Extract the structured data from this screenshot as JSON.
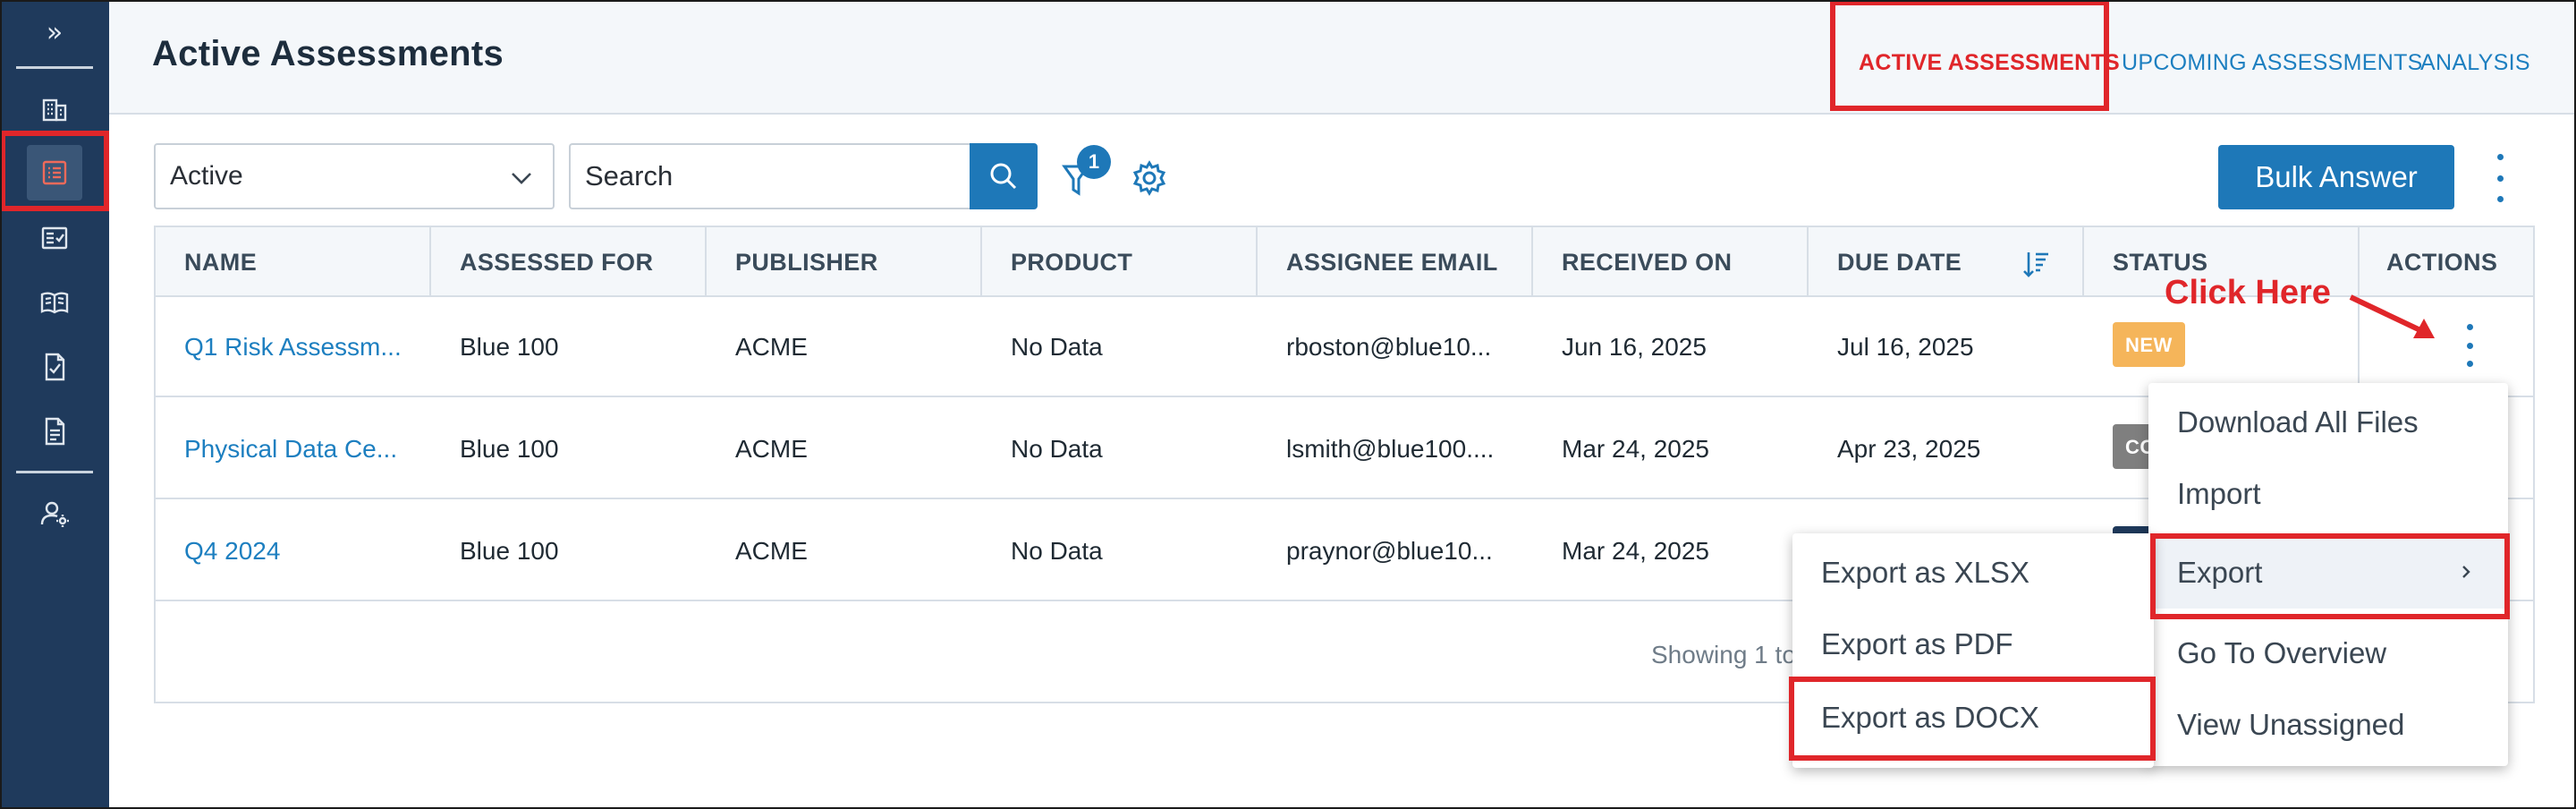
{
  "sidebar": {
    "expand_label": "»",
    "items": [
      {
        "icon": "building-icon"
      },
      {
        "icon": "assessments-icon",
        "active": true
      },
      {
        "icon": "checklist-icon"
      },
      {
        "icon": "book-icon"
      },
      {
        "icon": "document-check-icon"
      },
      {
        "icon": "document-icon"
      },
      {
        "icon": "user-settings-icon"
      }
    ]
  },
  "header": {
    "title": "Active Assessments",
    "tabs": [
      {
        "label": "ACTIVE ASSESSMENTS",
        "active": true
      },
      {
        "label": "UPCOMING ASSESSMENTS"
      },
      {
        "label": "ANALYSIS"
      }
    ]
  },
  "toolbar": {
    "status_select": "Active",
    "search_placeholder": "Search",
    "filter_count": "1",
    "bulk_label": "Bulk Answer"
  },
  "table": {
    "columns": [
      "NAME",
      "ASSESSED FOR",
      "PUBLISHER",
      "PRODUCT",
      "ASSIGNEE EMAIL",
      "RECEIVED ON",
      "DUE DATE",
      "STATUS",
      "ACTIONS"
    ],
    "rows": [
      {
        "name": "Q1 Risk Assessm...",
        "assessed_for": "Blue 100",
        "publisher": "ACME",
        "product": "No Data",
        "email": "rboston@blue10...",
        "received": "Jun 16, 2025",
        "due": "Jul 16, 2025",
        "status": "NEW",
        "status_color": "#f5b55a"
      },
      {
        "name": "Physical Data Ce...",
        "assessed_for": "Blue 100",
        "publisher": "ACME",
        "product": "No Data",
        "email": "lsmith@blue100....",
        "received": "Mar 24, 2025",
        "due": "Apr 23, 2025",
        "status": "CO",
        "status_color": "#7f7f7f"
      },
      {
        "name": "Q4 2024",
        "assessed_for": "Blue 100",
        "publisher": "ACME",
        "product": "No Data",
        "email": "praynor@blue10...",
        "received": "Mar 24, 2025",
        "due": "",
        "status": "",
        "status_color": "#1f3a5c"
      }
    ],
    "footer": "Showing 1 to"
  },
  "annotation": {
    "text": "Click Here",
    "color": "#e0262a"
  },
  "actions_menu": [
    "Download All Files",
    "Import",
    "Export",
    "Go To Overview",
    "View Unassigned"
  ],
  "export_menu": [
    "Export as XLSX",
    "Export as PDF",
    "Export as DOCX"
  ],
  "colors": {
    "primary": "#1e78b8",
    "sidebar": "#1f3a5c",
    "highlight": "#e0262a"
  }
}
